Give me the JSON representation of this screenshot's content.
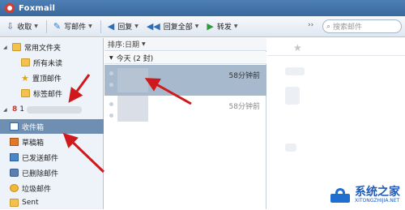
{
  "app": {
    "title": "Foxmail"
  },
  "toolbar": {
    "receive": "收取",
    "compose": "写邮件",
    "reply": "回复",
    "reply_all": "回复全部",
    "forward": "转发",
    "overflow": "››",
    "search_placeholder": "搜索邮件"
  },
  "sidebar": {
    "common_folder": "常用文件夹",
    "items_common": [
      "所有未读",
      "置顶邮件",
      "标签邮件"
    ],
    "account_prefix": "1",
    "items_account": [
      "收件箱",
      "草稿箱",
      "已发送邮件",
      "已删除邮件",
      "垃圾邮件",
      "Sent"
    ]
  },
  "list": {
    "sort_label": "排序:日期",
    "group_label": "今天 (2 封)",
    "mails": [
      {
        "time": "58分钟前"
      },
      {
        "time": "58分钟前"
      }
    ]
  },
  "watermark": {
    "main": "系统之家",
    "sub": "XITONGZHIJIA.NET"
  },
  "colors": {
    "arrow": "#d0191c",
    "selection": "#6f8fb2",
    "titlebar": "#3f6fa5"
  }
}
